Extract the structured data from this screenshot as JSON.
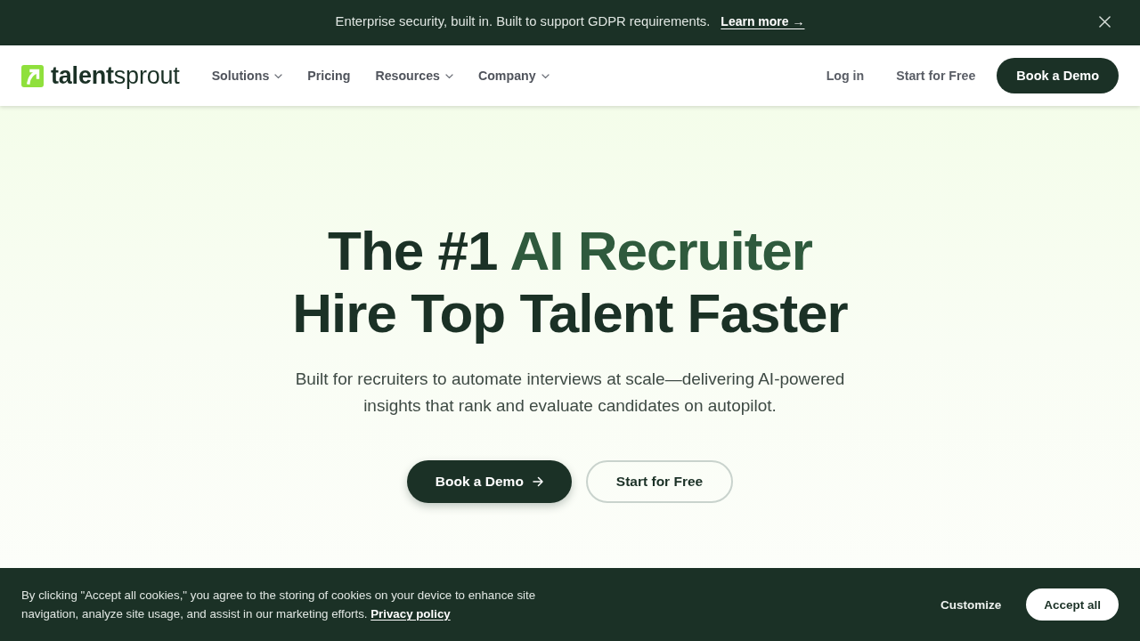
{
  "announcement": {
    "text": "Enterprise security, built in. Built to support GDPR requirements.",
    "link": "Learn more →",
    "dismissible": true
  },
  "nav": {
    "logo": "**talent**sprout",
    "items": [
      {
        "label": "Solutions",
        "has_menu": true
      },
      {
        "label": "Pricing",
        "has_menu": false
      },
      {
        "label": "Resources",
        "has_menu": true
      },
      {
        "label": "Company",
        "has_menu": true
      }
    ],
    "actions": [
      {
        "label": "Log in",
        "kind": "link"
      },
      {
        "label": "Start for Free",
        "kind": "link"
      },
      {
        "label": "Book a Demo",
        "kind": "primary"
      }
    ]
  },
  "hero": {
    "headline": [
      [
        {
          "text": "The #1 ",
          "accent": false
        },
        {
          "text": "AI Recruiter",
          "accent": true
        }
      ],
      [
        {
          "text": "Hire Top Talent Faster",
          "accent": false
        }
      ]
    ],
    "subtitle": "Built for recruiters to automate interviews at scale—delivering AI-powered insights that rank and evaluate candidates on autopilot.",
    "buttons": [
      {
        "label": "Book a Demo",
        "kind": "primary",
        "arrow": true
      },
      {
        "label": "Start for Free",
        "kind": "secondary",
        "arrow": false
      }
    ]
  },
  "cookie_banner": {
    "text": "By clicking \"Accept all cookies,\" you agree to the storing of cookies on your device to enhance site navigation, analyze site usage, and assist in our marketing efforts.",
    "link": "Privacy policy",
    "buttons": [
      {
        "label": "Customize",
        "kind": "text"
      },
      {
        "label": "Accept all",
        "kind": "primary"
      }
    ]
  }
}
